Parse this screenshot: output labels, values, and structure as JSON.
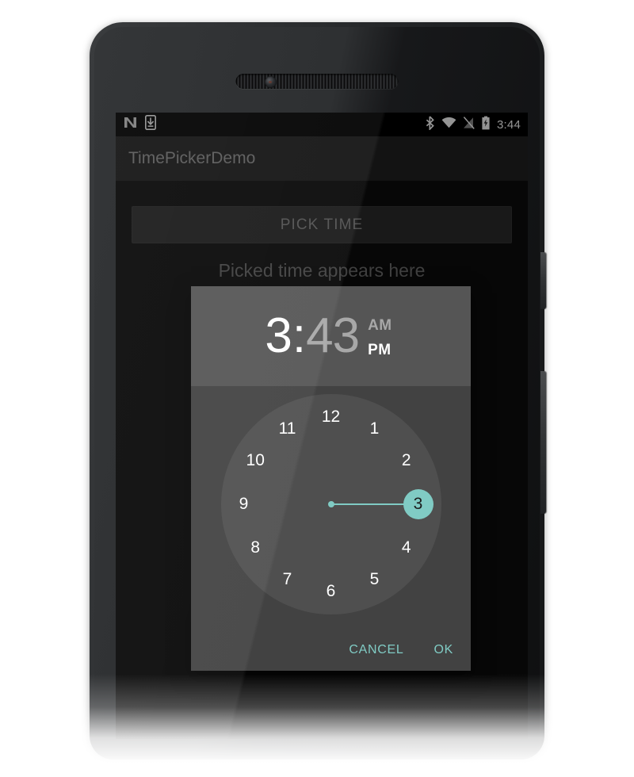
{
  "status_bar": {
    "time": "3:44",
    "left_icons": [
      "android-n-logo-icon",
      "system-update-icon"
    ],
    "right_icons": [
      "bluetooth-icon",
      "wifi-icon",
      "no-sim-signal-icon",
      "battery-charging-icon"
    ]
  },
  "app": {
    "title": "TimePickerDemo",
    "pick_time_label": "PICK TIME",
    "result_text": "Picked time appears here"
  },
  "dialog": {
    "hour": "3",
    "colon": ":",
    "minute": "43",
    "am_label": "AM",
    "pm_label": "PM",
    "selected_meridiem": "PM",
    "selected_hour": 3,
    "hours": [
      "12",
      "1",
      "2",
      "3",
      "4",
      "5",
      "6",
      "7",
      "8",
      "9",
      "10",
      "11"
    ],
    "cancel_label": "CANCEL",
    "ok_label": "OK"
  },
  "colors": {
    "accent": "#80cbc4",
    "dialog_body": "#424242",
    "dialog_header": "#555555",
    "clock_face": "#4f4f4f",
    "app_bar": "#212121",
    "screen_bg": "#0d0d0d"
  }
}
